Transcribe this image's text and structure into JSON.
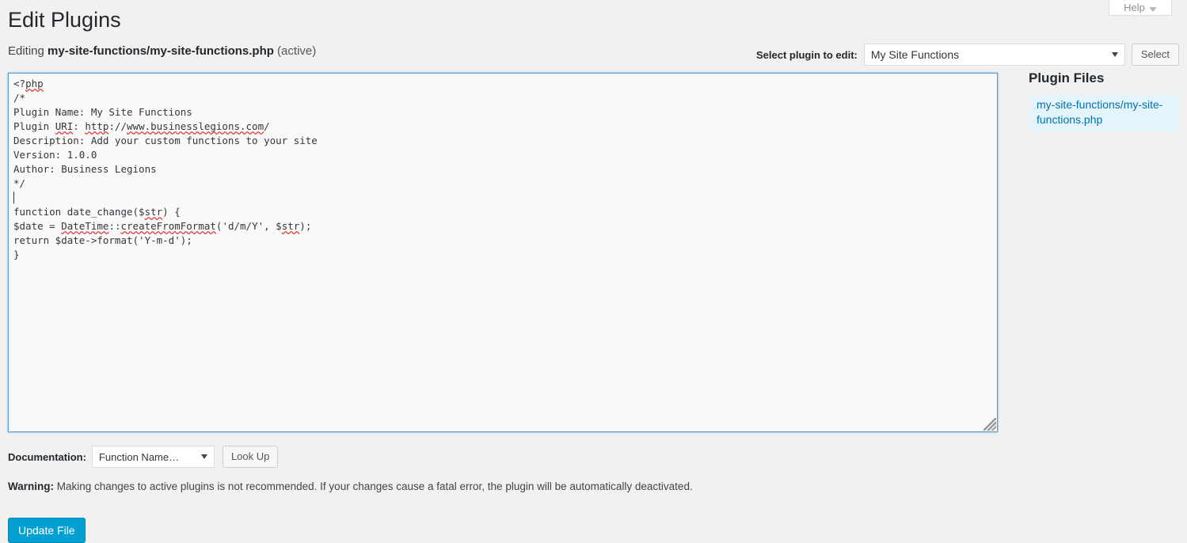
{
  "help_tab": {
    "label": "Help",
    "icon": "chevron-down-icon"
  },
  "page": {
    "title": "Edit Plugins",
    "editing_prefix": "Editing ",
    "editing_file": "my-site-functions/my-site-functions.php",
    "editing_state": " (active)"
  },
  "plugin_selector": {
    "label": "Select plugin to edit:",
    "selected": "My Site Functions",
    "button_label": "Select",
    "options": [
      "My Site Functions"
    ]
  },
  "editor": {
    "lines": [
      "<?php",
      "/*",
      "Plugin Name: My Site Functions",
      "Plugin URI: http://www.businesslegions.com/",
      "Description: Add your custom functions to your site",
      "Version: 1.0.0",
      "Author: Business Legions",
      "*/",
      "",
      "function date_change($str) {",
      "$date = DateTime::createFromFormat('d/m/Y', $str);",
      "return $date->format('Y-m-d');",
      "}"
    ],
    "caret_line_index": 8,
    "misspelled_words": [
      "php",
      "URI",
      "http",
      "www.businesslegions.com",
      "str",
      "DateTime",
      "createFromFormat"
    ],
    "resize_handle": "resize-grip-icon"
  },
  "plugin_files": {
    "title": "Plugin Files",
    "items": [
      {
        "label": "my-site-functions/my-site-functions.php",
        "active": true
      }
    ]
  },
  "documentation": {
    "label": "Documentation:",
    "selected": "Function Name…",
    "button_label": "Look Up",
    "options": [
      "Function Name…"
    ]
  },
  "warning": {
    "strong": "Warning:",
    "text": " Making changes to active plugins is not recommended. If your changes cause a fatal error, the plugin will be automatically deactivated."
  },
  "submit": {
    "label": "Update File"
  },
  "colors": {
    "page_background": "#f1f1f1",
    "link_blue": "#0073aa",
    "primary_button": "#00a0d2",
    "editor_focus_border": "#5b9dd9",
    "editor_background": "#f9f9f9",
    "file_active_background": "#e5f4fb",
    "spellcheck_underline": "#e03a3a"
  }
}
